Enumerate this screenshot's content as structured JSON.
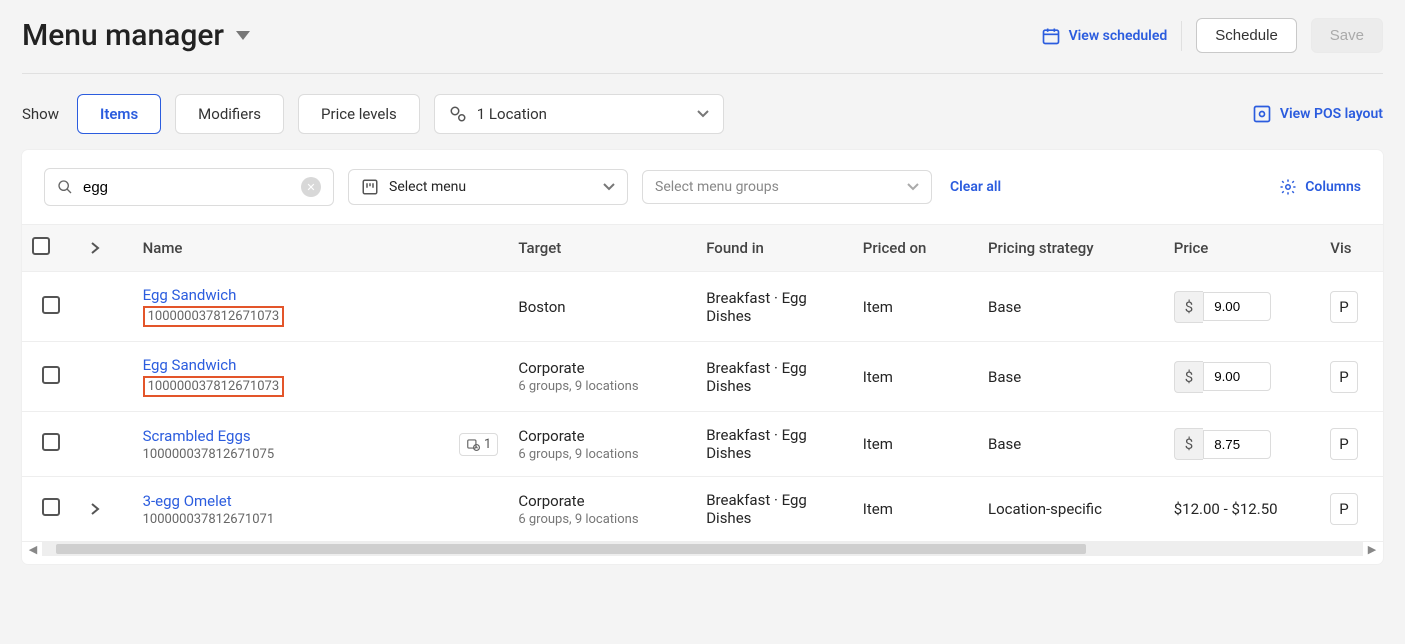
{
  "header": {
    "title": "Menu manager",
    "view_scheduled": "View scheduled",
    "schedule": "Schedule",
    "save": "Save"
  },
  "filters": {
    "show_label": "Show",
    "tabs": {
      "items": "Items",
      "modifiers": "Modifiers",
      "price_levels": "Price levels"
    },
    "location_select": "1 Location",
    "view_pos": "View POS layout"
  },
  "toolbar": {
    "search_value": "egg",
    "select_menu_label": "Select menu",
    "select_groups_placeholder": "Select menu groups",
    "clear_all": "Clear all",
    "columns": "Columns"
  },
  "table": {
    "headers": {
      "name": "Name",
      "target": "Target",
      "found_in": "Found in",
      "priced_on": "Priced on",
      "strategy": "Pricing strategy",
      "price": "Price",
      "visibility": "Vis"
    },
    "rows": [
      {
        "name": "Egg Sandwich",
        "id": "100000037812671073",
        "id_highlighted": true,
        "expandable": false,
        "scheduled_count": null,
        "target": "Boston",
        "target_sub": "",
        "found_in": "Breakfast · Egg Dishes",
        "priced_on": "Item",
        "strategy": "Base",
        "price_prefix": "$",
        "price_value": "9.00",
        "price_editable": true,
        "visibility": "P"
      },
      {
        "name": "Egg Sandwich",
        "id": "100000037812671073",
        "id_highlighted": true,
        "expandable": false,
        "scheduled_count": null,
        "target": "Corporate",
        "target_sub": "6 groups, 9 locations",
        "found_in": "Breakfast · Egg Dishes",
        "priced_on": "Item",
        "strategy": "Base",
        "price_prefix": "$",
        "price_value": "9.00",
        "price_editable": true,
        "visibility": "P"
      },
      {
        "name": "Scrambled Eggs",
        "id": "100000037812671075",
        "id_highlighted": false,
        "expandable": false,
        "scheduled_count": "1",
        "target": "Corporate",
        "target_sub": "6 groups, 9 locations",
        "found_in": "Breakfast · Egg Dishes",
        "priced_on": "Item",
        "strategy": "Base",
        "price_prefix": "$",
        "price_value": "8.75",
        "price_editable": true,
        "visibility": "P"
      },
      {
        "name": "3-egg Omelet",
        "id": "100000037812671071",
        "id_highlighted": false,
        "expandable": true,
        "scheduled_count": null,
        "target": "Corporate",
        "target_sub": "6 groups, 9 locations",
        "found_in": "Breakfast · Egg Dishes",
        "priced_on": "Item",
        "strategy": "Location-specific",
        "price_prefix": "",
        "price_value": "$12.00 - $12.50",
        "price_editable": false,
        "visibility": "P"
      }
    ]
  }
}
